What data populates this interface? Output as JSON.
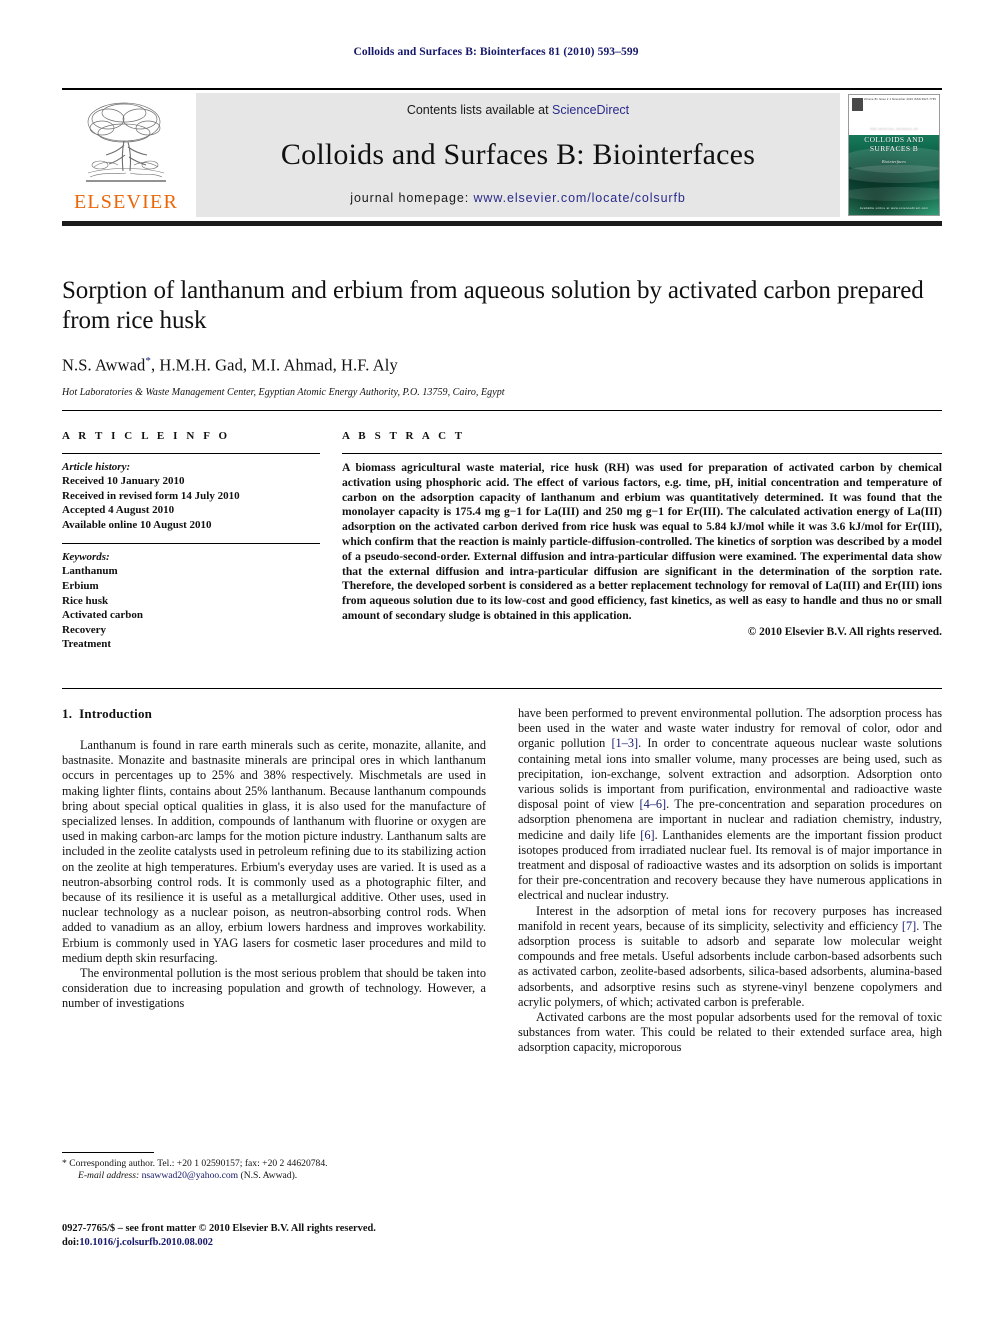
{
  "running_head": "Colloids and Surfaces B: Biointerfaces 81 (2010) 593–599",
  "header": {
    "contents_prefix": "Contents lists available at ",
    "sciencedirect": "ScienceDirect",
    "journal_title": "Colloids and Surfaces B: Biointerfaces",
    "homepage_prefix": "journal homepage: ",
    "homepage_url": "www.elsevier.com/locate/colsurfb",
    "elsevier_wordmark": "ELSEVIER",
    "cover": {
      "masthead_small": "THE OFFICIAL JOURNAL OF",
      "title": "COLLOIDS AND SURFACES B",
      "subtitle": "Biointerfaces",
      "top_strip": "Volume 81 Issue 2 1 November 2010 ISSN 0927-7765",
      "footer": "Available online at www.sciencedirect.com"
    },
    "colors": {
      "link_blue": "#2a2a8c",
      "elsevier_orange": "#ec6608",
      "banner_gray": "#e6e6e6",
      "cover_green": "#0d5f46"
    }
  },
  "article": {
    "title": "Sorption of lanthanum and erbium from aqueous solution by activated carbon prepared from rice husk",
    "authors": "N.S. Awwad",
    "authors_rest": ", H.M.H. Gad, M.I. Ahmad, H.F. Aly",
    "corresponding_marker": "*",
    "affiliation": "Hot Laboratories & Waste Management Center, Egyptian Atomic Energy Authority, P.O. 13759, Cairo, Egypt"
  },
  "info": {
    "heading": "A R T I C L E   I N F O",
    "history_title": "Article history:",
    "history": [
      "Received 10 January 2010",
      "Received in revised form 14 July 2010",
      "Accepted 4 August 2010",
      "Available online 10 August 2010"
    ],
    "keywords_title": "Keywords:",
    "keywords": [
      "Lanthanum",
      "Erbium",
      "Rice husk",
      "Activated carbon",
      "Recovery",
      "Treatment"
    ]
  },
  "abstract": {
    "heading": "A B S T R A C T",
    "text": "A biomass agricultural waste material, rice husk (RH) was used for preparation of activated carbon by chemical activation using phosphoric acid. The effect of various factors, e.g. time, pH, initial concentration and temperature of carbon on the adsorption capacity of lanthanum and erbium was quantitatively determined. It was found that the monolayer capacity is 175.4 mg g−1 for La(III) and 250 mg g−1 for Er(III). The calculated activation energy of La(III) adsorption on the activated carbon derived from rice husk was equal to 5.84 kJ/mol while it was 3.6 kJ/mol for Er(III), which confirm that the reaction is mainly particle-diffusion-controlled. The kinetics of sorption was described by a model of a pseudo-second-order. External diffusion and intra-particular diffusion were examined. The experimental data show that the external diffusion and intra-particular diffusion are significant in the determination of the sorption rate. Therefore, the developed sorbent is considered as a better replacement technology for removal of La(III) and Er(III) ions from aqueous solution due to its low-cost and good efficiency, fast kinetics, as well as easy to handle and thus no or small amount of secondary sludge is obtained in this application.",
    "copyright": "© 2010 Elsevier B.V. All rights reserved."
  },
  "body": {
    "section_number": "1.",
    "section_title": "Introduction",
    "left_paragraphs": [
      "Lanthanum is found in rare earth minerals such as cerite, monazite, allanite, and bastnasite. Monazite and bastnasite minerals are principal ores in which lanthanum occurs in percentages up to 25% and 38% respectively. Mischmetals are used in making lighter flints, contains about 25% lanthanum. Because lanthanum compounds bring about special optical qualities in glass, it is also used for the manufacture of specialized lenses. In addition, compounds of lanthanum with fluorine or oxygen are used in making carbon-arc lamps for the motion picture industry. Lanthanum salts are included in the zeolite catalysts used in petroleum refining due to its stabilizing action on the zeolite at high temperatures. Erbium's everyday uses are varied. It is used as a neutron-absorbing control rods. It is commonly used as a photographic filter, and because of its resilience it is useful as a metallurgical additive. Other uses, used in nuclear technology as a nuclear poison, as neutron-absorbing control rods. When added to vanadium as an alloy, erbium lowers hardness and improves workability. Erbium is commonly used in YAG lasers for cosmetic laser procedures and mild to medium depth skin resurfacing.",
      "The environmental pollution is the most serious problem that should be taken into consideration due to increasing population and growth of technology. However, a number of investigations"
    ],
    "right_paragraph_1_part1": "have been performed to prevent environmental pollution. The adsorption process has been used in the water and waste water industry for removal of color, odor and organic pollution ",
    "right_cite_1": "[1–3]",
    "right_paragraph_1_part2": ". In order to concentrate aqueous nuclear waste solutions containing metal ions into smaller volume, many processes are being used, such as precipitation, ion-exchange, solvent extraction and adsorption. Adsorption onto various solids is important from purification, environmental and radioactive waste disposal point of view ",
    "right_cite_2": "[4–6]",
    "right_paragraph_1_part3": ". The pre-concentration and separation procedures on adsorption phenomena are important in nuclear and radiation chemistry, industry, medicine and daily life ",
    "right_cite_3": "[6]",
    "right_paragraph_1_part4": ". Lanthanides elements are the important fission product isotopes produced from irradiated nuclear fuel. Its removal is of major importance in treatment and disposal of radioactive wastes and its adsorption on solids is important for their pre-concentration and recovery because they have numerous applications in electrical and nuclear industry.",
    "right_paragraph_2_part1": "Interest in the adsorption of metal ions for recovery purposes has increased manifold in recent years, because of its simplicity, selectivity and efficiency ",
    "right_cite_4": "[7]",
    "right_paragraph_2_part2": ". The adsorption process is suitable to adsorb and separate low molecular weight compounds and free metals. Useful adsorbents include carbon-based adsorbents such as activated carbon, zeolite-based adsorbents, silica-based adsorbents, alumina-based adsorbents, and adsorptive resins such as styrene-vinyl benzene copolymers and acrylic polymers, of which; activated carbon is preferable.",
    "right_paragraph_3": "Activated carbons are the most popular adsorbents used for the removal of toxic substances from water. This could be related to their extended surface area, high adsorption capacity, microporous"
  },
  "footnote": {
    "marker": "*",
    "corresponding": "Corresponding author. Tel.: +20 1 02590157; fax: +20 2 44620784.",
    "email_label": "E-mail address:",
    "email": "nsawwad20@yahoo.com",
    "email_suffix": "(N.S. Awwad)."
  },
  "footer": {
    "issn_line": "0927-7765/$ – see front matter © 2010 Elsevier B.V. All rights reserved.",
    "doi_prefix": "doi:",
    "doi": "10.1016/j.colsurfb.2010.08.002"
  }
}
